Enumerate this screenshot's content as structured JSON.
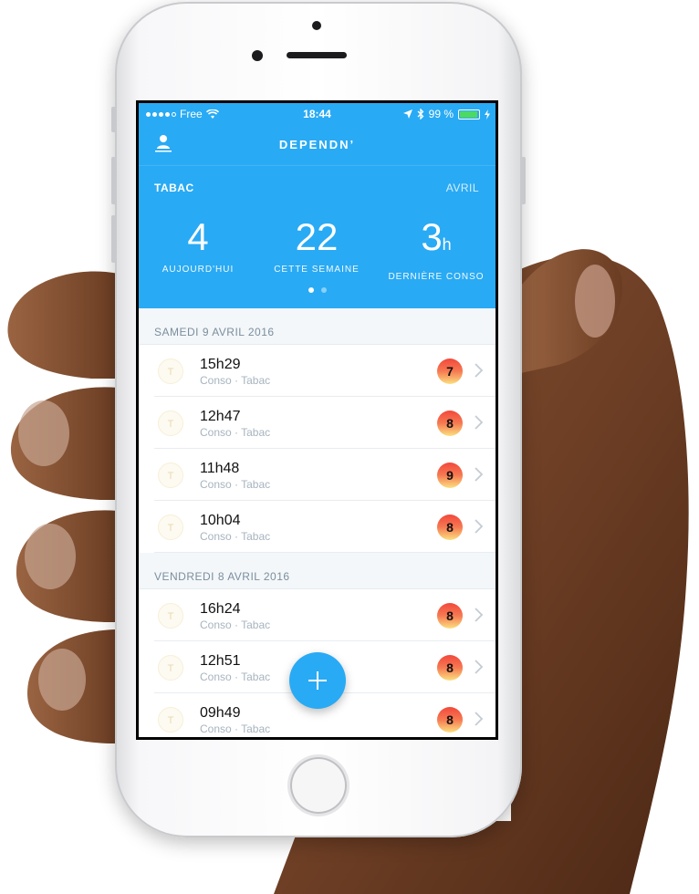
{
  "colors": {
    "accent": "#29aaf4",
    "badge_red": "#f2483c",
    "badge_yellow": "#fbe07f",
    "battery_green": "#4cd964"
  },
  "status_bar": {
    "carrier": "Free",
    "time": "18:44",
    "battery": "99 %",
    "icons": [
      "wifi-icon",
      "location-icon",
      "bluetooth-icon",
      "battery-icon",
      "charging-icon"
    ]
  },
  "nav": {
    "title": "DEPENDN’",
    "left_icon": "user-icon"
  },
  "summary": {
    "category": "TABAC",
    "month": "AVRIL",
    "stats": [
      {
        "value": "4",
        "unit": "",
        "label": "AUJOURD'HUI"
      },
      {
        "value": "22",
        "unit": "",
        "label": "CETTE SEMAINE"
      },
      {
        "value": "3",
        "unit": "h",
        "label": "DERNIÈRE CONSO"
      }
    ],
    "pages": 2,
    "active_page": 1
  },
  "sections": [
    {
      "header": "SAMEDI 9 AVRIL 2016",
      "entries": [
        {
          "avatar": "T",
          "time": "15h29",
          "subtitle": "Conso · Tabac",
          "score": "7"
        },
        {
          "avatar": "T",
          "time": "12h47",
          "subtitle": "Conso · Tabac",
          "score": "8"
        },
        {
          "avatar": "T",
          "time": "11h48",
          "subtitle": "Conso · Tabac",
          "score": "9"
        },
        {
          "avatar": "T",
          "time": "10h04",
          "subtitle": "Conso · Tabac",
          "score": "8"
        }
      ]
    },
    {
      "header": "VENDREDI 8 AVRIL 2016",
      "entries": [
        {
          "avatar": "T",
          "time": "16h24",
          "subtitle": "Conso · Tabac",
          "score": "8"
        },
        {
          "avatar": "T",
          "time": "12h51",
          "subtitle": "Conso · Tabac",
          "score": "8"
        },
        {
          "avatar": "T",
          "time": "09h49",
          "subtitle": "Conso · Tabac",
          "score": "8"
        }
      ]
    }
  ],
  "fab": {
    "icon": "plus-icon"
  }
}
